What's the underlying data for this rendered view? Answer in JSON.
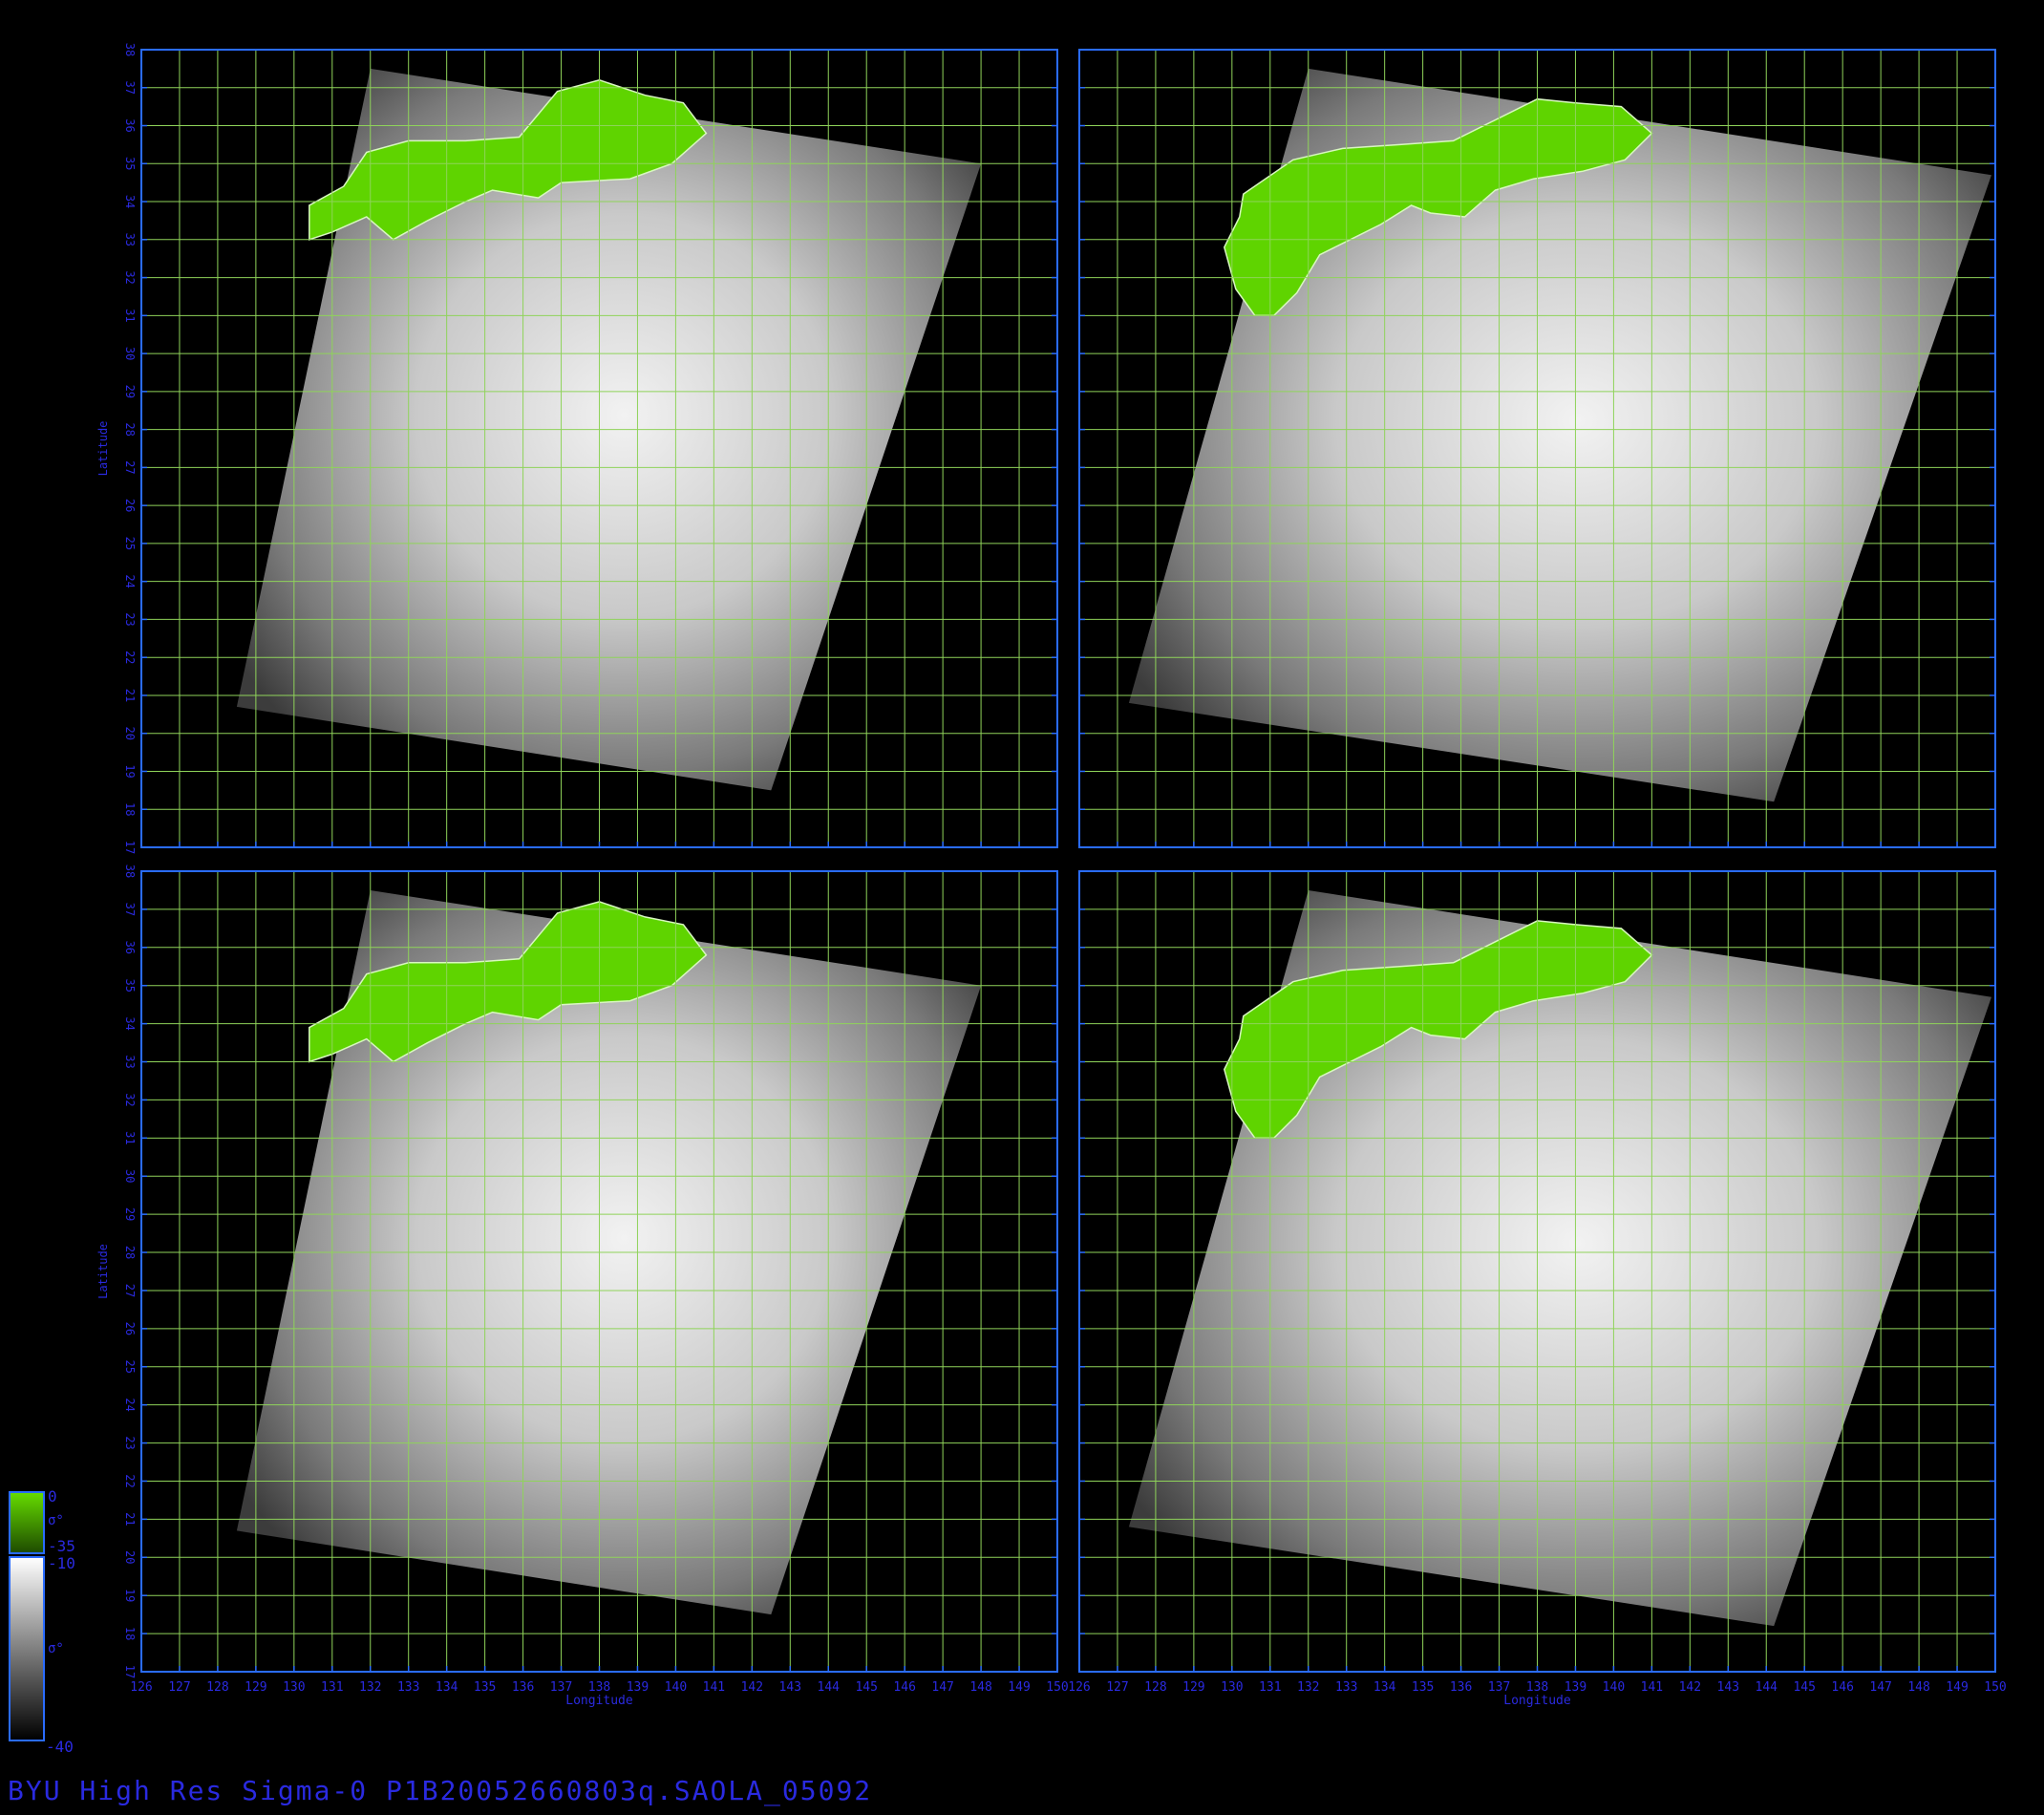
{
  "title": "BYU High Res Sigma-0 P1B20052660803q.SAOLA_05092",
  "axes": {
    "xlabel": "Longitude",
    "ylabel": "Latitude",
    "lon_range": [
      126,
      150
    ],
    "lat_range": [
      17,
      38
    ]
  },
  "panels": [
    {
      "id": "top-left",
      "lon_ticks_shown": false,
      "lat_ticks_shown": true
    },
    {
      "id": "top-right",
      "lon_ticks_shown": false,
      "lat_ticks_shown": false
    },
    {
      "id": "bottom-left",
      "lon_ticks_shown": true,
      "lat_ticks_shown": true
    },
    {
      "id": "bottom-right",
      "lon_ticks_shown": true,
      "lat_ticks_shown": false
    }
  ],
  "colorbar": {
    "land": {
      "top_label": "0",
      "symbol": "σ°",
      "bottom_label": "-35",
      "color": "#5fd400"
    },
    "ocean": {
      "top_label": "-10",
      "symbol": "σ°",
      "bottom_label": "-40"
    }
  },
  "colors": {
    "background": "#000000",
    "frame": "#2a6cff",
    "grid": "#8fd35a",
    "tick_text": "#2a2ae0",
    "land": "#5fd400"
  }
}
